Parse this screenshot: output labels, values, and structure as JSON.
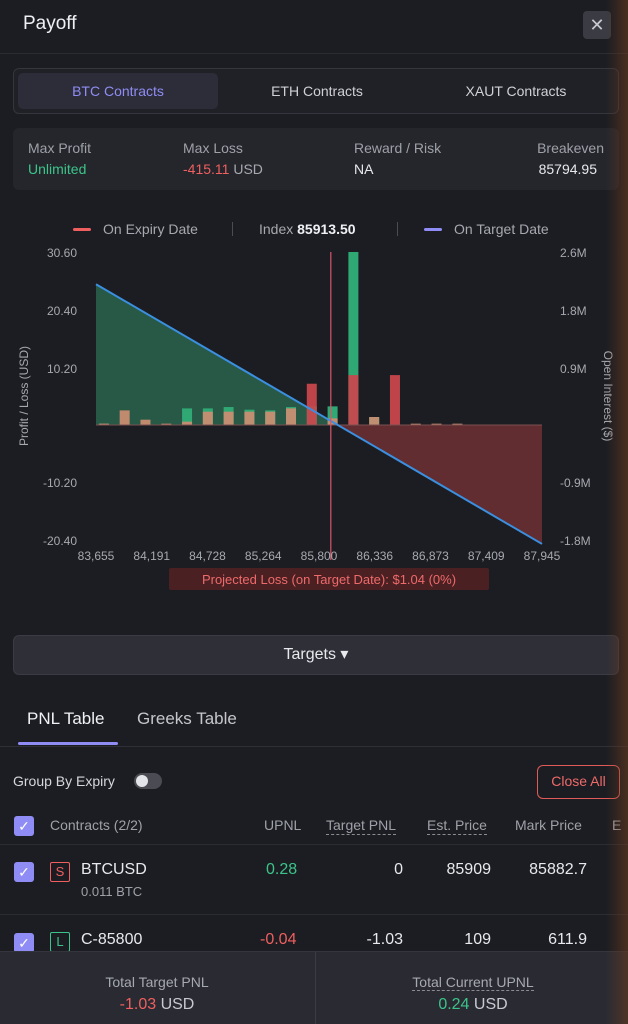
{
  "header": {
    "title": "Payoff",
    "close_glyph": "✕"
  },
  "contract_tabs": [
    "BTC Contracts",
    "ETH Contracts",
    "XAUT Contracts"
  ],
  "stats": {
    "max_profit_label": "Max Profit",
    "max_profit_value": "Unlimited",
    "max_loss_label": "Max Loss",
    "max_loss_value": "-415.11",
    "max_loss_unit": "USD",
    "reward_risk_label": "Reward / Risk",
    "reward_risk_value": "NA",
    "breakeven_label": "Breakeven",
    "breakeven_value": "85794.95"
  },
  "legend": {
    "expiry_label": "On Expiry Date",
    "index_label": "Index",
    "index_value": "85913.50",
    "target_label": "On Target Date",
    "expiry_color": "#ef5f5f",
    "target_color": "#8f8cf5"
  },
  "chart_data": {
    "type": "line",
    "ylabel": "Profit / Loss (USD)",
    "y2label": "Open Interest ($)",
    "y_ticks": [
      "30.60",
      "20.40",
      "10.20",
      "-10.20",
      "-20.40"
    ],
    "y2_ticks": [
      "2.6M",
      "1.8M",
      "0.9M",
      "-0.9M",
      "-1.8M"
    ],
    "x_ticks": [
      "83,655",
      "84,191",
      "84,728",
      "85,264",
      "85,800",
      "86,336",
      "86,873",
      "87,409",
      "87,945"
    ],
    "xlim": [
      83655,
      87945
    ],
    "ylim": [
      -20.4,
      30.6
    ],
    "y2lim": [
      -1.8,
      2.6
    ],
    "series": [
      {
        "x": [
          83655,
          87945
        ],
        "y": [
          24.9,
          -21.1
        ]
      }
    ],
    "index_price": 85913.5,
    "open_interest_bars": {
      "x": [
        83750,
        83950,
        84150,
        84350,
        84550,
        84750,
        84950,
        85150,
        85350,
        85550,
        85750,
        85950,
        86150,
        86350,
        86550,
        86750,
        86950,
        87150
      ],
      "call": [
        0.02,
        0.0,
        0.0,
        0.0,
        0.25,
        0.25,
        0.27,
        0.23,
        0.22,
        0.27,
        0.28,
        0.28,
        2.6,
        0.12,
        0.0,
        0.0,
        0.0,
        0.0
      ],
      "put": [
        0.02,
        0.22,
        0.08,
        0.02,
        0.05,
        0.2,
        0.2,
        0.2,
        0.2,
        0.25,
        0.62,
        0.1,
        0.75,
        0.12,
        0.75,
        0.02,
        0.02,
        0.02
      ]
    },
    "projection_label": "Projected Loss (on Target Date): $1.04 (0%)"
  },
  "targets_button": "Targets ▾",
  "table_tabs": [
    "PNL Table",
    "Greeks Table"
  ],
  "group_by_expiry": "Group By Expiry",
  "close_all": "Close All",
  "columns": [
    "Contracts (2/2)",
    "UPNL",
    "Target PNL",
    "Est. Price",
    "Mark Price",
    "E"
  ],
  "rows": [
    {
      "side": "S",
      "name": "BTCUSD",
      "size": "0.011 BTC",
      "upnl": "0.28",
      "target_pnl": "0",
      "est_price": "85909",
      "mark_price": "85882.7"
    },
    {
      "side": "L",
      "name": "C-85800",
      "size": "",
      "upnl": "-0.04",
      "target_pnl": "-1.03",
      "est_price": "109",
      "mark_price": "611.9"
    }
  ],
  "footer": {
    "target_label": "Total Target PNL",
    "target_value": "-1.03",
    "target_unit": "USD",
    "current_label": "Total Current UPNL",
    "current_value": "0.24",
    "current_unit": "USD"
  },
  "check_glyph": "✓"
}
